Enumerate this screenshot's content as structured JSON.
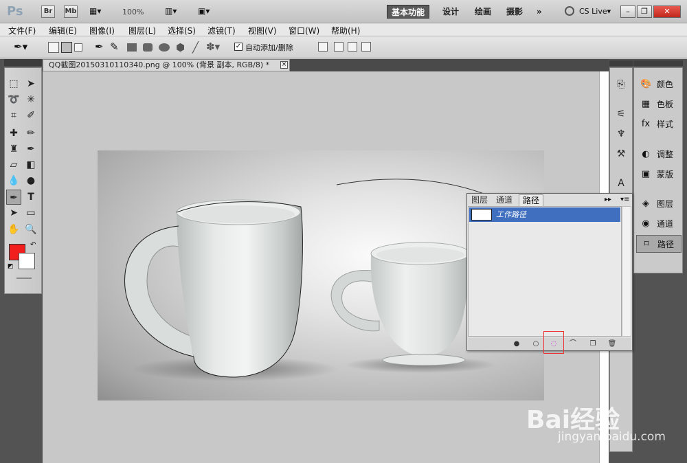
{
  "app": {
    "logo": "Ps",
    "bridge": "Br",
    "minibridge": "Mb",
    "zoom": "100%",
    "workspaces": [
      "基本功能",
      "设计",
      "绘画",
      "摄影",
      "»"
    ],
    "cslive": "CS Live▾"
  },
  "menu": [
    "文件(F)",
    "编辑(E)",
    "图像(I)",
    "图层(L)",
    "选择(S)",
    "滤镜(T)",
    "视图(V)",
    "窗口(W)",
    "帮助(H)"
  ],
  "options": {
    "auto_add_delete": "自动添加/删除"
  },
  "document": {
    "tab_title": "QQ截图20150310110340.png @ 100% (背景 副本, RGB/8) *",
    "close": "×"
  },
  "right_panels": [
    {
      "label": "颜色",
      "icon": "palette-icon"
    },
    {
      "label": "色板",
      "icon": "swatches-icon"
    },
    {
      "label": "样式",
      "icon": "styles-icon"
    },
    {
      "label": "调整",
      "icon": "adjustments-icon"
    },
    {
      "label": "蒙版",
      "icon": "masks-icon"
    },
    {
      "label": "图层",
      "icon": "layers-icon"
    },
    {
      "label": "通道",
      "icon": "channels-icon"
    },
    {
      "label": "路径",
      "icon": "paths-icon"
    }
  ],
  "paths_panel": {
    "tabs": [
      "图层",
      "通道",
      "路径"
    ],
    "active_tab": "路径",
    "items": [
      "工作路径"
    ]
  },
  "colors": {
    "foreground": "#f21d1d",
    "background": "#ffffff",
    "selection": "#3f6fbe"
  },
  "watermark": {
    "brand": "Bai经验",
    "url": "jingyan.baidu.com"
  }
}
